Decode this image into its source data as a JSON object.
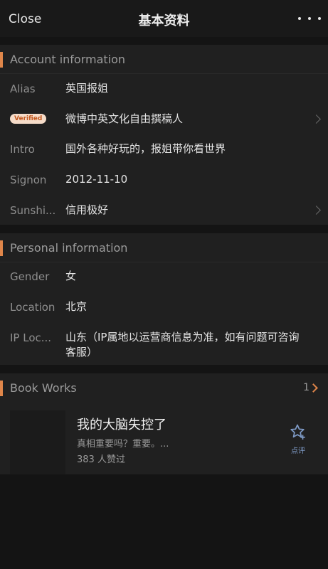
{
  "nav": {
    "close_label": "Close",
    "title": "基本资料",
    "more_icon": "more-horizontal-icon"
  },
  "account": {
    "title": "Account information",
    "accent_color": "#e0864a",
    "alias_label": "Alias",
    "alias_value": "英国报姐",
    "verified_badge": "Verified",
    "verified_value": "微博中英文化自由撰稿人",
    "intro_label": "Intro",
    "intro_value": "国外各种好玩的，报姐带你看世界",
    "signon_label": "Signon",
    "signon_value": "2012-11-10",
    "sunshine_label": "Sunshi...",
    "sunshine_value": "信用极好"
  },
  "personal": {
    "title": "Personal information",
    "gender_label": "Gender",
    "gender_value": "女",
    "location_label": "Location",
    "location_value": "北京",
    "ip_label": "IP Loc...",
    "ip_value": "山东（IP属地以运营商信息为准，如有问题可咨询客服）"
  },
  "books": {
    "title": "Book Works",
    "count": "1",
    "item": {
      "title": "我的大脑失控了",
      "desc": "真相重要吗？重要。...",
      "likes": "383 人赞过",
      "review_label": "点评",
      "review_icon": "star-plus-icon",
      "review_color": "#7f9bc7"
    }
  }
}
